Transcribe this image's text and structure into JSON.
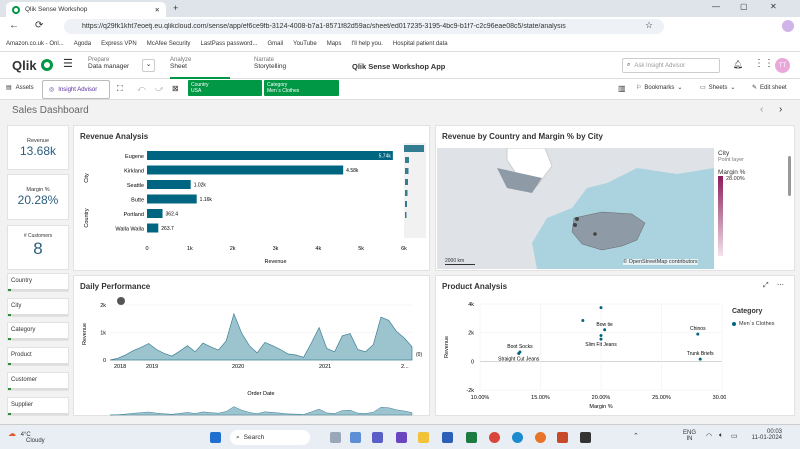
{
  "browser": {
    "tab_title": "Qlik Sense Workshop",
    "url": "https://q29fk1kht7eoetj.eu.qlikcloud.com/sense/app/ef6ce9fb-3124-4008-b7a1-8571f82d59ac/sheet/ed017235-3195-4bc9-b1f7-c2c96eae08c5/state/analysis",
    "bookmarks": [
      "Amazon.co.uk - Onl...",
      "Agoda",
      "Express VPN",
      "McAfee Security",
      "LastPass password...",
      "Gmail",
      "YouTube",
      "Maps",
      "I'll help you.",
      "Hospital patient data"
    ]
  },
  "qlik": {
    "logo": "Qlik",
    "nav": [
      {
        "top": "Prepare",
        "bottom": "Data manager"
      },
      {
        "top": "Analyze",
        "bottom": "Sheet"
      },
      {
        "top": "Narrate",
        "bottom": "Storytelling"
      }
    ],
    "app_title": "Qlik Sense Workshop App",
    "search_placeholder": "Ask Insight Advisor",
    "avatar": "TT"
  },
  "toolbar": {
    "assets": "Assets",
    "insight": "Insight Advisor",
    "selections": [
      {
        "field": "Country",
        "value": "USA"
      },
      {
        "field": "Category",
        "value": "Men´s Clothes"
      }
    ],
    "bookmarks": "Bookmarks",
    "sheets": "Sheets",
    "edit": "Edit sheet"
  },
  "sheet_title": "Sales Dashboard",
  "kpis": [
    {
      "label": "Revenue",
      "value": "13.68k"
    },
    {
      "label": "Margin %",
      "value": "20.28%"
    },
    {
      "label": "# Customers",
      "value": "8"
    }
  ],
  "filters": [
    "Country",
    "City",
    "Category",
    "Product",
    "Customer",
    "Supplier"
  ],
  "charts": {
    "revenue_title": "Revenue Analysis",
    "map_title": "Revenue by Country and Margin % by City",
    "daily_title": "Daily Performance",
    "product_title": "Product Analysis",
    "map_legend": {
      "title": "City",
      "subtitle": "Point layer",
      "measure": "Margin %",
      "max": "28.00%"
    },
    "map_scale": "2000 km",
    "map_credit": "© OpenStreetMap contributors",
    "scatter_legend_title": "Category",
    "scatter_legend_item": "Men´s Clothes"
  },
  "chart_data": [
    {
      "type": "bar",
      "title": "Revenue Analysis",
      "categories": [
        "Eugene",
        "Kirkland",
        "Seattle",
        "Butte",
        "Portland",
        "Walla Walla"
      ],
      "values": [
        5740,
        4580,
        1020,
        1160,
        362.4,
        263.7
      ],
      "labels": [
        "5.74k",
        "4.58k",
        "1.02k",
        "1.16k",
        "362.4",
        "263.7"
      ],
      "xlabel": "Revenue",
      "dim_labels": [
        "City",
        "Country"
      ],
      "xlim": [
        0,
        6000
      ],
      "xticks": [
        "0",
        "1k",
        "2k",
        "3k",
        "4k",
        "5k",
        "6k"
      ]
    },
    {
      "type": "area",
      "title": "Daily Performance",
      "ylabel": "Revenue",
      "xlabel": "Order Date",
      "ylim": [
        0,
        2000
      ],
      "yticks": [
        "0",
        "1k",
        "2k"
      ],
      "xticks": [
        "2018",
        "2019",
        "2020",
        "2021",
        "2..."
      ],
      "end_label": "(0)",
      "values": [
        0,
        60,
        180,
        340,
        460,
        600,
        380,
        240,
        140,
        320,
        520,
        300,
        620,
        480,
        360,
        700,
        1680,
        980,
        520,
        260,
        640,
        520,
        380,
        220,
        180,
        100,
        620,
        1180,
        420,
        300,
        880,
        960,
        380,
        300,
        560,
        1560,
        1440,
        1040,
        800,
        480
      ]
    },
    {
      "type": "scatter",
      "title": "Product Analysis",
      "xlabel": "Margin %",
      "ylabel": "Revenue",
      "xlim": [
        10,
        30
      ],
      "ylim": [
        -2000,
        4000
      ],
      "xticks": [
        "10.00%",
        "15.00%",
        "20.00%",
        "25.00%",
        "30.00%"
      ],
      "yticks": [
        "4k",
        "2k",
        "0",
        "-2k"
      ],
      "points": [
        {
          "label": "",
          "x": 18.5,
          "y": 2850
        },
        {
          "label": "",
          "x": 20.0,
          "y": 3750
        },
        {
          "label": "Bow tie",
          "x": 20.3,
          "y": 2200
        },
        {
          "label": "",
          "x": 20.0,
          "y": 1800
        },
        {
          "label": "Slim Fit Jeans",
          "x": 20.0,
          "y": 1550
        },
        {
          "label": "Boot Socks",
          "x": 13.3,
          "y": 650
        },
        {
          "label": "Straight Cut Jeans",
          "x": 13.2,
          "y": 550
        },
        {
          "label": "Chinos",
          "x": 28.0,
          "y": 1900
        },
        {
          "label": "Trunk Briefs",
          "x": 28.2,
          "y": 150
        }
      ]
    }
  ],
  "taskbar": {
    "weather_temp": "4°C",
    "weather_desc": "Cloudy",
    "search": "Search",
    "lang": "ENG",
    "region": "IN",
    "time": "00:03",
    "date": "11-01-2024"
  },
  "colors": {
    "bar": "#006580",
    "area": "#9cc4cf",
    "line": "#3f7f93",
    "chip": "#009845",
    "accent": "#2c8a3a",
    "map_land": "#dfe3e8",
    "map_water": "#aad3df"
  }
}
